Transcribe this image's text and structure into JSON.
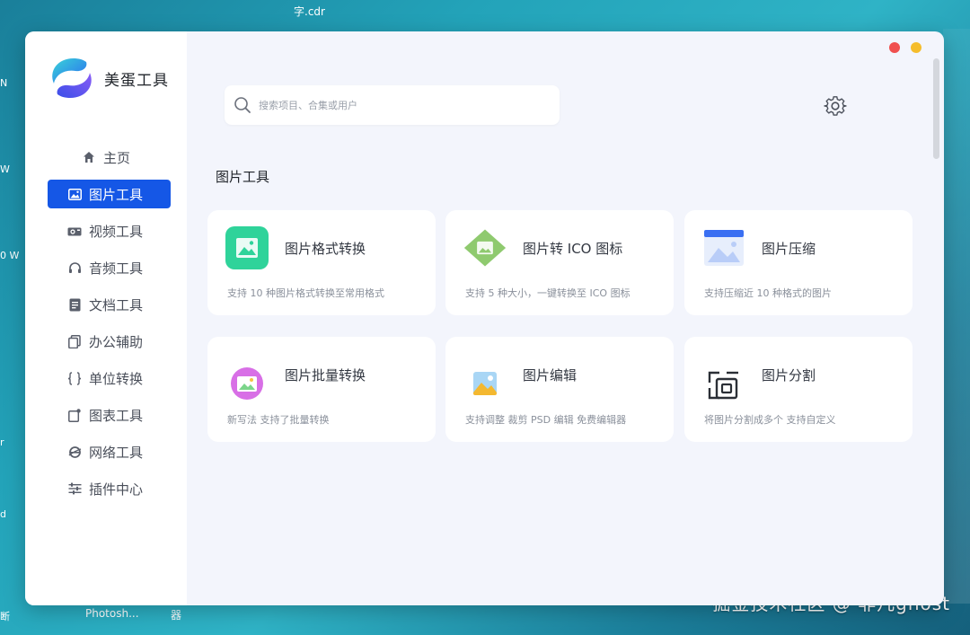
{
  "desktop": {
    "file_label": "字.cdr",
    "taskbar_label": "Photosh...",
    "taskbar_label_2": "器",
    "watermark": "掘金技术社区 @ 非凡ghost",
    "left_marks": [
      "N",
      "W",
      "0 W",
      "r",
      "d",
      "断"
    ]
  },
  "app": {
    "name": "美蛋工具",
    "window_controls": {
      "close_color": "#f0504f",
      "minimize_color": "#f5bd2c"
    },
    "accent": "#1557e6"
  },
  "sidebar": {
    "items": [
      {
        "label": "主页",
        "icon": "home-icon",
        "active": false
      },
      {
        "label": "图片工具",
        "icon": "image-icon",
        "active": true
      },
      {
        "label": "视频工具",
        "icon": "video-icon",
        "active": false
      },
      {
        "label": "音频工具",
        "icon": "headphones-icon",
        "active": false
      },
      {
        "label": "文档工具",
        "icon": "document-icon",
        "active": false
      },
      {
        "label": "办公辅助",
        "icon": "copy-icon",
        "active": false
      },
      {
        "label": "单位转换",
        "icon": "braces-icon",
        "active": false
      },
      {
        "label": "图表工具",
        "icon": "chart-icon",
        "active": false
      },
      {
        "label": "网络工具",
        "icon": "browser-icon",
        "active": false
      },
      {
        "label": "插件中心",
        "icon": "sliders-icon",
        "active": false
      }
    ]
  },
  "search": {
    "placeholder": "搜索项目、合集或用户",
    "value": ""
  },
  "section": {
    "title": "图片工具"
  },
  "cards": [
    {
      "title": "图片格式转换",
      "desc": "支持 10 种图片格式转换至常用格式",
      "icon": "image-convert-icon"
    },
    {
      "title": "图片转 ICO 图标",
      "desc": "支持 5 种大小，一键转换至 ICO 图标",
      "icon": "ico-convert-icon"
    },
    {
      "title": "图片压缩",
      "desc": "支持压缩近 10 种格式的图片",
      "icon": "image-compress-icon"
    },
    {
      "title": "图片批量转换",
      "desc": "新写法 支持了批量转换",
      "icon": "batch-convert-icon"
    },
    {
      "title": "图片编辑",
      "desc": "支持调整 裁剪 PSD 编辑  免费编辑器",
      "icon": "image-edit-icon"
    },
    {
      "title": "图片分割",
      "desc": "将图片分割成多个 支持自定义",
      "icon": "image-split-icon"
    }
  ]
}
